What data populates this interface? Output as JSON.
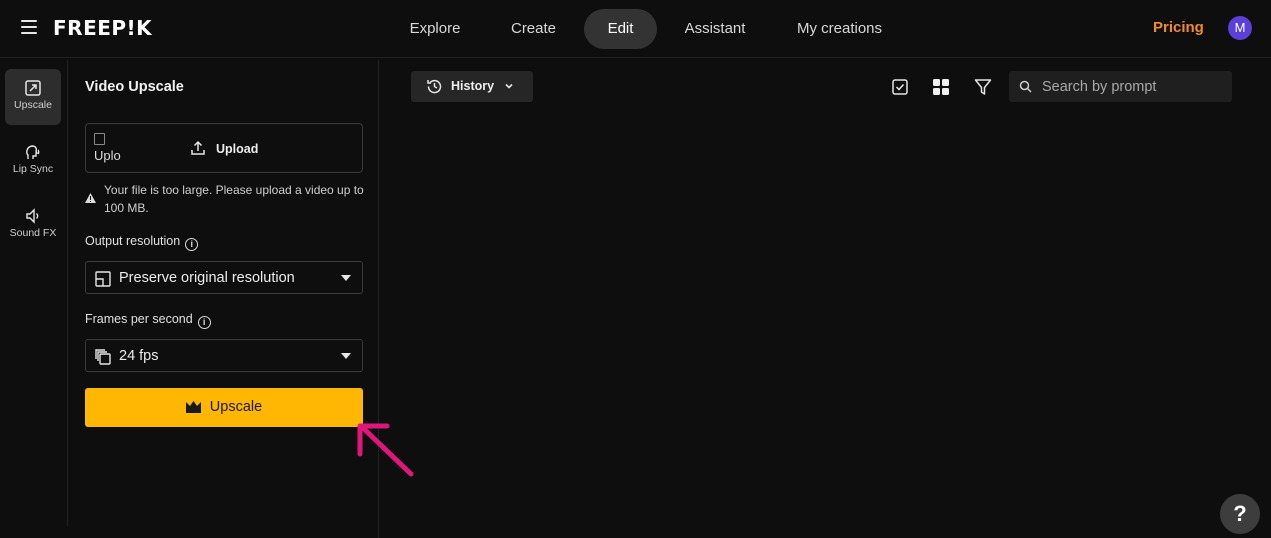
{
  "header": {
    "logo": "FREEP!K",
    "nav": [
      {
        "label": "Explore",
        "active": false
      },
      {
        "label": "Create",
        "active": false
      },
      {
        "label": "Edit",
        "active": true
      },
      {
        "label": "Assistant",
        "active": false
      },
      {
        "label": "My creations",
        "active": false
      }
    ],
    "pricing": "Pricing",
    "avatar_initial": "M"
  },
  "rail": {
    "items": [
      {
        "label": "Upscale",
        "icon": "upscale-icon",
        "active": true
      },
      {
        "label": "Lip Sync",
        "icon": "lip-sync-icon",
        "active": false
      },
      {
        "label": "Sound FX",
        "icon": "speaker-icon",
        "active": false
      }
    ]
  },
  "panel": {
    "title": "Video Upscale",
    "thumbnail_alt": "Uplo",
    "upload_label": "Upload",
    "warning": "Your file is too large. Please upload a video up to 100 MB.",
    "output_resolution_label": "Output resolution",
    "output_resolution_value": "Preserve original resolution",
    "fps_label": "Frames per second",
    "fps_value": "24 fps",
    "upscale_button": "Upscale"
  },
  "toolbar": {
    "history_label": "History",
    "search_placeholder": "Search by prompt"
  },
  "help": "?",
  "colors": {
    "accent": "#ffb703",
    "pricing": "#f28c28",
    "avatar": "#5b3fd6",
    "annotation_arrow": "#e0177a"
  }
}
